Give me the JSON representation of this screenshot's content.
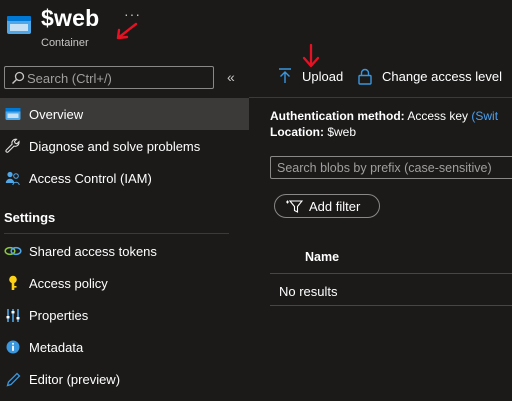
{
  "header": {
    "title": "$web",
    "subtitle": "Container",
    "more": "···"
  },
  "sidebar": {
    "search_placeholder": "Search (Ctrl+/)",
    "collapse": "«",
    "items": [
      {
        "label": "Overview",
        "icon": "container-icon",
        "active": true
      },
      {
        "label": "Diagnose and solve problems",
        "icon": "wrench-icon"
      },
      {
        "label": "Access Control (IAM)",
        "icon": "people-icon"
      }
    ],
    "settings_title": "Settings",
    "settings_items": [
      {
        "label": "Shared access tokens",
        "icon": "link-icon"
      },
      {
        "label": "Access policy",
        "icon": "key-icon"
      },
      {
        "label": "Properties",
        "icon": "sliders-icon"
      },
      {
        "label": "Metadata",
        "icon": "info-icon"
      },
      {
        "label": "Editor (preview)",
        "icon": "pencil-icon"
      }
    ]
  },
  "toolbar": {
    "upload_label": "Upload",
    "change_access_label": "Change access level"
  },
  "info": {
    "auth_label": "Authentication method:",
    "auth_value": "Access key",
    "auth_switch": "(Swit",
    "location_label": "Location:",
    "location_value": "$web"
  },
  "blob_search_placeholder": "Search blobs by prefix (case-sensitive)",
  "add_filter_label": "Add filter",
  "table": {
    "columns": [
      "Name"
    ],
    "empty_text": "No results"
  },
  "colors": {
    "background": "#1b1a19",
    "selected": "#3b3a39",
    "accent": "#4aa0f0",
    "annotation": "#e81123"
  }
}
